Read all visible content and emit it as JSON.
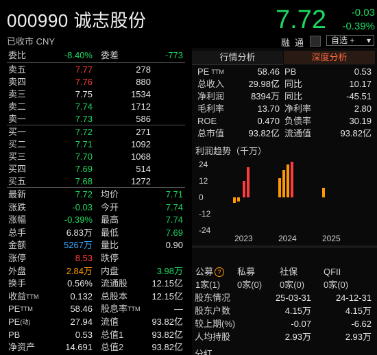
{
  "header": {
    "code_name": "000990 诚志股份",
    "status": "已收市 CNY",
    "price": "7.72",
    "change": "-0.03",
    "change_pct": "-0.39%",
    "btn_rong": "融",
    "btn_tong": "通",
    "zixuan": "自选 +",
    "menu": "▾"
  },
  "quote": {
    "weibi_label": "委比",
    "weibi": "-8.40%",
    "weicha_label": "委差",
    "weicha": "-773",
    "asks": [
      {
        "label": "卖五",
        "price": "7.77",
        "vol": "278"
      },
      {
        "label": "卖四",
        "price": "7.76",
        "vol": "880"
      },
      {
        "label": "卖三",
        "price": "7.75",
        "vol": "1534"
      },
      {
        "label": "卖二",
        "price": "7.74",
        "vol": "1712"
      },
      {
        "label": "卖一",
        "price": "7.73",
        "vol": "586"
      }
    ],
    "bids": [
      {
        "label": "买一",
        "price": "7.72",
        "vol": "271"
      },
      {
        "label": "买二",
        "price": "7.71",
        "vol": "1092"
      },
      {
        "label": "买三",
        "price": "7.70",
        "vol": "1068"
      },
      {
        "label": "买四",
        "price": "7.69",
        "vol": "514"
      },
      {
        "label": "买五",
        "price": "7.68",
        "vol": "1272"
      }
    ],
    "stats": [
      {
        "l1": "最新",
        "v1": "7.72",
        "l2": "均价",
        "v2": "7.71"
      },
      {
        "l1": "涨跌",
        "v1": "-0.03",
        "l2": "今开",
        "v2": "7.74"
      },
      {
        "l1": "涨幅",
        "v1": "-0.39%",
        "l2": "最高",
        "v2": "7.74"
      },
      {
        "l1": "总手",
        "v1": "6.83万",
        "l2": "最低",
        "v2": "7.69"
      },
      {
        "l1": "金额",
        "v1": "5267万",
        "l2": "量比",
        "v2": "0.90"
      },
      {
        "l1": "涨停",
        "v1": "8.53",
        "l2": "跌停",
        "v2": ""
      },
      {
        "l1": "外盘",
        "v1": "2.84万",
        "l2": "内盘",
        "v2": "3.98万"
      },
      {
        "l1": "换手",
        "v1": "0.56%",
        "l2": "流通股",
        "v2": "12.15亿"
      },
      {
        "l1": "收益",
        "v1": "0.132",
        "l2": "总股本",
        "v2": "12.15亿"
      },
      {
        "l1": "PE",
        "v1": "58.46",
        "l2": "股息率",
        "v2": "—"
      },
      {
        "l1": "PE",
        "v1": "27.94",
        "l2": "流值",
        "v2": "93.82亿"
      },
      {
        "l1": "PB",
        "v1": "0.53",
        "l2": "总值1",
        "v2": "93.82亿"
      },
      {
        "l1": "净资产",
        "v1": "14.691",
        "l2": "总值2",
        "v2": "93.82亿"
      }
    ],
    "ttm": "TTM",
    "dong": "(动)"
  },
  "right": {
    "tab1": "行情分析",
    "tab2": "深度分析",
    "metrics": [
      {
        "l1": "PE",
        "v1": "58.46",
        "l2": "PB",
        "v2": "0.53"
      },
      {
        "l1": "总收入",
        "v1": "29.98亿",
        "l2": "同比",
        "v2": "10.17"
      },
      {
        "l1": "净利润",
        "v1": "8394万",
        "l2": "同比",
        "v2": "-45.51"
      },
      {
        "l1": "毛利率",
        "v1": "13.70",
        "l2": "净利率",
        "v2": "2.80"
      },
      {
        "l1": "ROE",
        "v1": "0.470",
        "l2": "负债率",
        "v2": "30.19"
      },
      {
        "l1": "总市值",
        "v1": "93.82亿",
        "l2": "流通值",
        "v2": "93.82亿"
      }
    ],
    "chart_title": "利润趋势（千万）",
    "holders": {
      "headers": [
        "公募",
        "私募",
        "社保",
        "QFII"
      ],
      "values": [
        "1家(1)",
        "0家(0)",
        "0家(0)",
        "0家(0)"
      ],
      "rows": [
        {
          "label": "股东情况",
          "a": "25-03-31",
          "b": "24-12-31"
        },
        {
          "label": "股东户数",
          "a": "4.15万",
          "b": "4.15万"
        },
        {
          "label": "较上期(%)",
          "a": "-0.07",
          "b": "-6.62"
        },
        {
          "label": "人均持股",
          "a": "2.93万",
          "b": "2.93万"
        }
      ],
      "footer": "分红"
    }
  },
  "chart_data": {
    "type": "bar",
    "title": "利润趋势（千万）",
    "x_ticks": [
      "2023",
      "2024",
      "2025"
    ],
    "y_ticks": [
      24,
      12,
      0,
      -12,
      -24
    ],
    "ylim": [
      -30,
      30
    ],
    "series": [
      {
        "color": "#ff9900",
        "values": [
          -3,
          -2,
          10,
          13,
          17,
          20,
          22,
          7
        ]
      },
      {
        "color": "#ff3b3b",
        "values": [
          0,
          0,
          20,
          0,
          0,
          0,
          0,
          0
        ]
      }
    ],
    "bars": [
      {
        "x": "2023Q1",
        "value": -4,
        "color": "#ff9900"
      },
      {
        "x": "2023Q2",
        "value": -3,
        "color": "#ff9900"
      },
      {
        "x": "2023Q3",
        "value": 12,
        "color": "#ff3b3b"
      },
      {
        "x": "2023Q4",
        "value": 22,
        "color": "#ff3b3b"
      },
      {
        "x": "2024Q1",
        "value": 14,
        "color": "#ff9900"
      },
      {
        "x": "2024Q2",
        "value": 20,
        "color": "#ff9900"
      },
      {
        "x": "2024Q3",
        "value": 24,
        "color": "#ff9900"
      },
      {
        "x": "2024Q4",
        "value": 26,
        "color": "#ff3b3b"
      },
      {
        "x": "2025Q1",
        "value": 7,
        "color": "#ff9900"
      }
    ]
  }
}
